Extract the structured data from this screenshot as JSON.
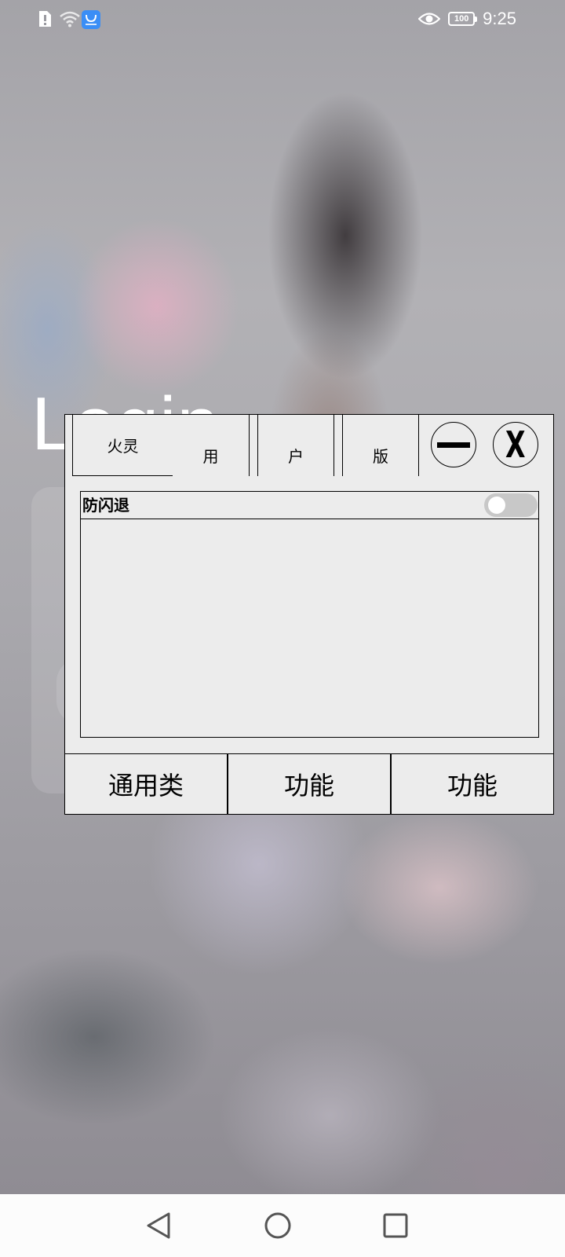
{
  "status_bar": {
    "time": "9:25",
    "battery_level": "100",
    "icons": [
      "sim-alert-icon",
      "wifi-icon",
      "app-store-icon",
      "eye-icon"
    ]
  },
  "background": {
    "login_title": "Login"
  },
  "panel": {
    "brand_tab": "火灵",
    "tabs": [
      "用",
      "户",
      "版"
    ],
    "minimize_icon": "minimize-icon",
    "close_icon": "close-icon",
    "close_glyph": "X",
    "option": {
      "label": "防闪退",
      "toggle_on": false
    },
    "bottom_tabs": [
      "通用类",
      "功能",
      "功能"
    ]
  },
  "colors": {
    "panel_bg": "#ececec",
    "border": "#000000",
    "toggle_track": "#c8c8c8",
    "nav_bg": "#fcfcfc"
  }
}
